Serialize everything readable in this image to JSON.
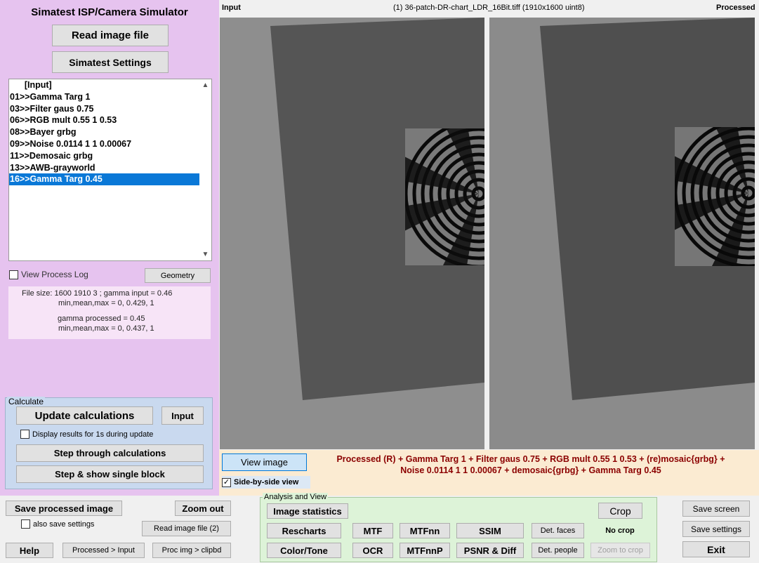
{
  "app": {
    "title": "Simatest ISP/Camera Simulator"
  },
  "top_buttons": {
    "read_image": "Read image file",
    "settings": "Simatest Settings"
  },
  "process_list": {
    "items": [
      "      [Input]",
      "01>>Gamma Targ 1",
      "03>>Filter gaus 0.75",
      "06>>RGB mult 0.55 1 0.53",
      "08>>Bayer grbg",
      "09>>Noise 0.0114 1 1 0.00067",
      "11>>Demosaic grbg",
      "13>>AWB-grayworld",
      "16>>Gamma Targ 0.45"
    ],
    "selected_index": 8,
    "scroll_up_icon": "chevron-up-icon",
    "scroll_down_icon": "chevron-down-icon"
  },
  "options": {
    "view_process_log": "View Process Log",
    "geometry": "Geometry"
  },
  "info": {
    "line1": "File size:  1600  1910     3 ;   gamma input = 0.46",
    "line2": "min,mean,max = 0, 0.429, 1",
    "line3": "gamma processed = 0.45",
    "line4": "min,mean,max = 0, 0.437, 1"
  },
  "calculate": {
    "legend": "Calculate",
    "update": "Update calculations",
    "input": "Input",
    "display_results": "Display results for 1s during update",
    "step_through": "Step through calculations",
    "step_single": "Step & show single block"
  },
  "viewer": {
    "left_label": "Input",
    "center_label": "(1) 36-patch-DR-chart_LDR_16Bit.tiff  (1910x1600  uint8)",
    "right_label": "Processed"
  },
  "view_controls": {
    "view_image": "View image",
    "side_by_side": "Side-by-side view",
    "side_by_side_checked": true
  },
  "summary": {
    "line1": "Processed (R)  + Gamma Targ 1 + Filter gaus 0.75 + RGB mult 0.55 1 0.53 + (re)mosaic{grbg} +",
    "line2": "Noise 0.0114 1 1 0.00067 + demosaic{grbg} + Gamma Targ 0.45"
  },
  "footer_left": {
    "save_processed": "Save processed image",
    "zoom_out": "Zoom out",
    "also_save_settings": "also save settings",
    "read_image_2": "Read image file (2)",
    "help": "Help",
    "processed_to_input": "Processed > Input",
    "proc_img_clipbd": "Proc img > clipbd"
  },
  "analysis": {
    "legend": "Analysis and View",
    "image_statistics": "Image statistics",
    "crop": "Crop",
    "rescharts": "Rescharts",
    "mtf": "MTF",
    "mtfnn": "MTFnn",
    "ssim": "SSIM",
    "det_faces": "Det. faces",
    "no_crop": "No crop",
    "color_tone": "Color/Tone",
    "ocr": "OCR",
    "mtfnnp": "MTFnnP",
    "psnr_diff": "PSNR & Diff",
    "det_people": "Det. people",
    "zoom_to_crop": "Zoom to crop"
  },
  "footer_right": {
    "save_screen": "Save screen",
    "save_settings": "Save settings",
    "exit": "Exit"
  },
  "colors": {
    "left_panel": "#e6c3ef",
    "selection": "#0a78d7",
    "summary_text": "#8b0000",
    "calc_group": "#c9d9ef",
    "analysis_group": "#ddf3d8",
    "bottom_strip": "#fbebd2"
  }
}
